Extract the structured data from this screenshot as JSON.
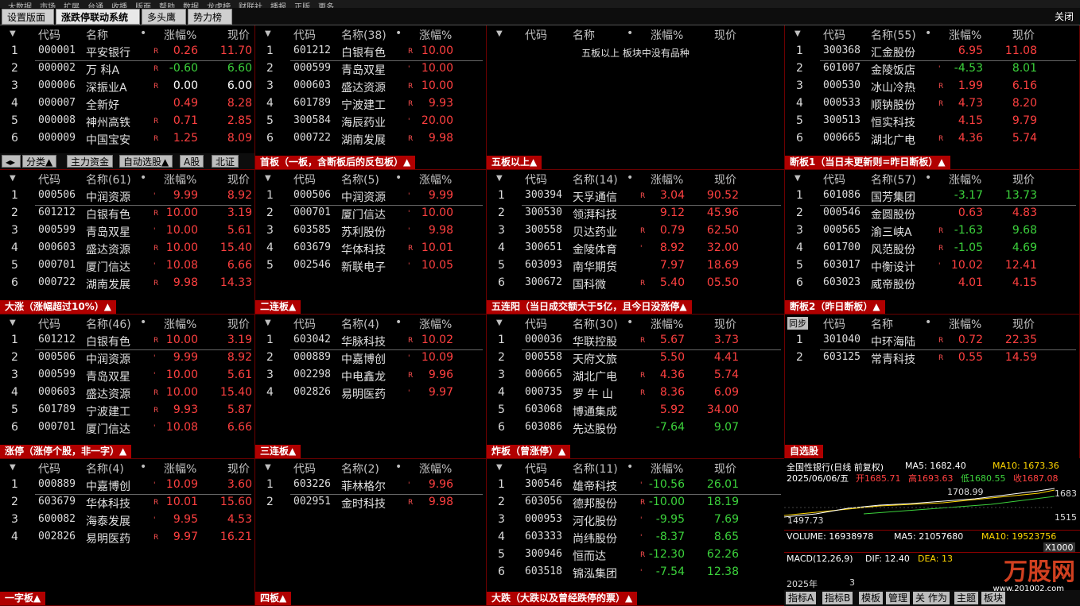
{
  "menubar": [
    "大数据",
    "市场",
    "扩展",
    "台通",
    "收播",
    "版面",
    "帮助",
    "数据",
    "龙虎榜",
    "财联社",
    "播报",
    "正版",
    "更多"
  ],
  "tabs": [
    {
      "label": "设置版面"
    },
    {
      "label": "涨跌停联动系统",
      "active": true
    },
    {
      "label": "多头鹰"
    },
    {
      "label": "势力榜"
    }
  ],
  "close_label": "关闭",
  "ctrl_buttons": [
    "分类▲",
    "主力资金",
    "自动选股▲",
    "A股",
    "北证"
  ],
  "panels": [
    {
      "id": "p1",
      "hdr_name": "名称",
      "foot": "",
      "rows": [
        {
          "code": "000001",
          "name": "平安银行",
          "mk": "R",
          "chg": "0.26",
          "price": "11.70",
          "dir": "up"
        },
        {
          "code": "000002",
          "name": "万 科A",
          "mk": "R",
          "chg": "-0.60",
          "price": "6.60",
          "dir": "dn"
        },
        {
          "code": "000006",
          "name": "深振业A",
          "mk": "R",
          "chg": "0.00",
          "price": "6.00",
          "dir": "fl"
        },
        {
          "code": "000007",
          "name": "全新好",
          "mk": "",
          "chg": "0.49",
          "price": "8.28",
          "dir": "up"
        },
        {
          "code": "000008",
          "name": "神州高铁",
          "mk": "R",
          "chg": "0.71",
          "price": "2.85",
          "dir": "up"
        },
        {
          "code": "000009",
          "name": "中国宝安",
          "mk": "R",
          "chg": "1.25",
          "price": "8.09",
          "dir": "up"
        }
      ]
    },
    {
      "id": "p2",
      "hdr_name": "名称(38)",
      "foot": "首板（一板，含断板后的反包板）▲",
      "rows": [
        {
          "code": "601212",
          "name": "白银有色",
          "mk": "R",
          "chg": "10.00",
          "dir": "up"
        },
        {
          "code": "000599",
          "name": "青岛双星",
          "mk": "'",
          "chg": "10.00",
          "dir": "up"
        },
        {
          "code": "000603",
          "name": "盛达资源",
          "mk": "R",
          "chg": "10.00",
          "dir": "up"
        },
        {
          "code": "601789",
          "name": "宁波建工",
          "mk": "R",
          "chg": "9.93",
          "dir": "up"
        },
        {
          "code": "300584",
          "name": "海辰药业",
          "mk": "'",
          "chg": "20.00",
          "dir": "up"
        },
        {
          "code": "000722",
          "name": "湖南发展",
          "mk": "R",
          "chg": "9.98",
          "dir": "up"
        }
      ]
    },
    {
      "id": "p3",
      "hdr_name": "名称",
      "foot": "五板以上▲",
      "empty": "五板以上 板块中没有品种",
      "rows": []
    },
    {
      "id": "p4",
      "hdr_name": "名称(55)",
      "foot": "断板1（当日未更新则=昨日断板）▲",
      "rows": [
        {
          "code": "300368",
          "name": "汇金股份",
          "mk": "",
          "chg": "6.95",
          "price": "11.08",
          "dir": "up"
        },
        {
          "code": "601007",
          "name": "金陵饭店",
          "mk": "'",
          "chg": "-4.53",
          "price": "8.01",
          "dir": "dn"
        },
        {
          "code": "000530",
          "name": "冰山冷热",
          "mk": "R",
          "chg": "1.99",
          "price": "6.16",
          "dir": "up"
        },
        {
          "code": "000533",
          "name": "顺钠股份",
          "mk": "R",
          "chg": "4.73",
          "price": "8.20",
          "dir": "up"
        },
        {
          "code": "300513",
          "name": "恒实科技",
          "mk": "",
          "chg": "4.15",
          "price": "9.79",
          "dir": "up"
        },
        {
          "code": "000665",
          "name": "湖北广电",
          "mk": "R",
          "chg": "4.36",
          "price": "5.74",
          "dir": "up"
        }
      ]
    },
    {
      "id": "p5",
      "hdr_name": "名称(61)",
      "foot": "大涨（涨幅超过10%）▲",
      "rows": [
        {
          "code": "000506",
          "name": "中润资源",
          "mk": "'",
          "chg": "9.99",
          "price": "8.92",
          "dir": "up"
        },
        {
          "code": "601212",
          "name": "白银有色",
          "mk": "R",
          "chg": "10.00",
          "price": "3.19",
          "dir": "up"
        },
        {
          "code": "000599",
          "name": "青岛双星",
          "mk": "'",
          "chg": "10.00",
          "price": "5.61",
          "dir": "up"
        },
        {
          "code": "000603",
          "name": "盛达资源",
          "mk": "R",
          "chg": "10.00",
          "price": "15.40",
          "dir": "up"
        },
        {
          "code": "000701",
          "name": "厦门信达",
          "mk": "'",
          "chg": "10.08",
          "price": "6.66",
          "dir": "up"
        },
        {
          "code": "000722",
          "name": "湖南发展",
          "mk": "R",
          "chg": "9.98",
          "price": "14.33",
          "dir": "up"
        }
      ]
    },
    {
      "id": "p6",
      "hdr_name": "名称(5)",
      "foot": "二连板▲",
      "rows": [
        {
          "code": "000506",
          "name": "中润资源",
          "mk": "'",
          "chg": "9.99",
          "dir": "up"
        },
        {
          "code": "000701",
          "name": "厦门信达",
          "mk": "'",
          "chg": "10.00",
          "dir": "up"
        },
        {
          "code": "603585",
          "name": "苏利股份",
          "mk": "'",
          "chg": "9.98",
          "dir": "up"
        },
        {
          "code": "603679",
          "name": "华体科技",
          "mk": "R",
          "chg": "10.01",
          "dir": "up"
        },
        {
          "code": "002546",
          "name": "新联电子",
          "mk": "'",
          "chg": "10.05",
          "dir": "up"
        }
      ]
    },
    {
      "id": "p7",
      "hdr_name": "名称(14)",
      "foot": "五连阳（当日成交额大于5亿，且今日没涨停▲",
      "rows": [
        {
          "code": "300394",
          "name": "天孚通信",
          "mk": "R",
          "chg": "3.04",
          "price": "90.52",
          "dir": "up"
        },
        {
          "code": "300530",
          "name": "领湃科技",
          "mk": "",
          "chg": "9.12",
          "price": "45.96",
          "dir": "up"
        },
        {
          "code": "300558",
          "name": "贝达药业",
          "mk": "R",
          "chg": "0.79",
          "price": "62.50",
          "dir": "up"
        },
        {
          "code": "300651",
          "name": "金陵体育",
          "mk": "'",
          "chg": "8.92",
          "price": "32.00",
          "dir": "up"
        },
        {
          "code": "603093",
          "name": "南华期货",
          "mk": "",
          "chg": "7.97",
          "price": "18.69",
          "dir": "up"
        },
        {
          "code": "300672",
          "name": "国科微",
          "mk": "R",
          "chg": "5.40",
          "price": "05.50",
          "dir": "up"
        }
      ]
    },
    {
      "id": "p8",
      "hdr_name": "名称(57)",
      "foot": "断板2（昨日断板）▲",
      "rows": [
        {
          "code": "601086",
          "name": "国芳集团",
          "mk": "",
          "chg": "-3.17",
          "price": "13.73",
          "dir": "dn"
        },
        {
          "code": "000546",
          "name": "金圆股份",
          "mk": "",
          "chg": "0.63",
          "price": "4.83",
          "dir": "up"
        },
        {
          "code": "000565",
          "name": "渝三峡A",
          "mk": "R",
          "chg": "-1.63",
          "price": "9.68",
          "dir": "dn"
        },
        {
          "code": "601700",
          "name": "风范股份",
          "mk": "R",
          "chg": "-1.05",
          "price": "4.69",
          "dir": "dn"
        },
        {
          "code": "603017",
          "name": "中衡设计",
          "mk": "'",
          "chg": "10.02",
          "price": "12.41",
          "dir": "up"
        },
        {
          "code": "603023",
          "name": "威帝股份",
          "mk": "",
          "chg": "4.01",
          "price": "4.15",
          "dir": "up"
        }
      ]
    },
    {
      "id": "p9",
      "hdr_name": "名称(46)",
      "foot": "涨停（涨停个股，非一字）▲",
      "rows": [
        {
          "code": "601212",
          "name": "白银有色",
          "mk": "R",
          "chg": "10.00",
          "price": "3.19",
          "dir": "up"
        },
        {
          "code": "000506",
          "name": "中润资源",
          "mk": "'",
          "chg": "9.99",
          "price": "8.92",
          "dir": "up"
        },
        {
          "code": "000599",
          "name": "青岛双星",
          "mk": "'",
          "chg": "10.00",
          "price": "5.61",
          "dir": "up"
        },
        {
          "code": "000603",
          "name": "盛达资源",
          "mk": "R",
          "chg": "10.00",
          "price": "15.40",
          "dir": "up"
        },
        {
          "code": "601789",
          "name": "宁波建工",
          "mk": "R",
          "chg": "9.93",
          "price": "5.87",
          "dir": "up"
        },
        {
          "code": "000701",
          "name": "厦门信达",
          "mk": "'",
          "chg": "10.08",
          "price": "6.66",
          "dir": "up"
        }
      ]
    },
    {
      "id": "p10",
      "hdr_name": "名称(4)",
      "foot": "三连板▲",
      "rows": [
        {
          "code": "603042",
          "name": "华脉科技",
          "mk": "R",
          "chg": "10.02",
          "dir": "up"
        },
        {
          "code": "000889",
          "name": "中嘉博创",
          "mk": "'",
          "chg": "10.09",
          "dir": "up"
        },
        {
          "code": "002298",
          "name": "中电鑫龙",
          "mk": "R",
          "chg": "9.96",
          "dir": "up"
        },
        {
          "code": "002826",
          "name": "易明医药",
          "mk": "'",
          "chg": "9.97",
          "dir": "up"
        }
      ]
    },
    {
      "id": "p11",
      "hdr_name": "名称(30)",
      "foot": "炸板（曾涨停）▲",
      "rows": [
        {
          "code": "000036",
          "name": "华联控股",
          "mk": "R",
          "chg": "5.67",
          "price": "3.73",
          "dir": "up"
        },
        {
          "code": "000558",
          "name": "天府文旅",
          "mk": "",
          "chg": "5.50",
          "price": "4.41",
          "dir": "up"
        },
        {
          "code": "000665",
          "name": "湖北广电",
          "mk": "R",
          "chg": "4.36",
          "price": "5.74",
          "dir": "up"
        },
        {
          "code": "000735",
          "name": "罗 牛 山",
          "mk": "R",
          "chg": "8.36",
          "price": "6.09",
          "dir": "up"
        },
        {
          "code": "603068",
          "name": "博通集成",
          "mk": "",
          "chg": "5.92",
          "price": "34.00",
          "dir": "up"
        },
        {
          "code": "603086",
          "name": "先达股份",
          "mk": "",
          "chg": "-7.64",
          "price": "9.07",
          "dir": "dn"
        }
      ]
    },
    {
      "id": "p12",
      "hdr_name": "名称",
      "foot": "自选股",
      "sync": "同步",
      "rows": [
        {
          "code": "301040",
          "name": "中环海陆",
          "mk": "R",
          "chg": "0.72",
          "price": "22.35",
          "dir": "up"
        },
        {
          "code": "603125",
          "name": "常青科技",
          "mk": "R",
          "chg": "0.55",
          "price": "14.59",
          "dir": "up"
        }
      ]
    },
    {
      "id": "p13",
      "hdr_name": "名称(4)",
      "foot": "一字板▲",
      "rows": [
        {
          "code": "000889",
          "name": "中嘉博创",
          "mk": "'",
          "chg": "10.09",
          "price": "3.60",
          "dir": "up"
        },
        {
          "code": "603679",
          "name": "华体科技",
          "mk": "R",
          "chg": "10.01",
          "price": "15.60",
          "dir": "up"
        },
        {
          "code": "600082",
          "name": "海泰发展",
          "mk": "'",
          "chg": "9.95",
          "price": "4.53",
          "dir": "up"
        },
        {
          "code": "002826",
          "name": "易明医药",
          "mk": "R",
          "chg": "9.97",
          "price": "16.21",
          "dir": "up"
        }
      ]
    },
    {
      "id": "p14",
      "hdr_name": "名称(2)",
      "foot": "四板▲",
      "rows": [
        {
          "code": "603226",
          "name": "菲林格尔",
          "mk": "'",
          "chg": "9.96",
          "dir": "up"
        },
        {
          "code": "002951",
          "name": "金时科技",
          "mk": "R",
          "chg": "9.98",
          "dir": "up"
        }
      ]
    },
    {
      "id": "p15",
      "hdr_name": "名称(11)",
      "foot": "大跌（大跌以及曾经跌停的票）▲",
      "rows": [
        {
          "code": "300546",
          "name": "雄帝科技",
          "mk": "'",
          "chg": "-10.56",
          "price": "26.01",
          "dir": "dn"
        },
        {
          "code": "603056",
          "name": "德邦股份",
          "mk": "R",
          "chg": "-10.00",
          "price": "18.19",
          "dir": "dn"
        },
        {
          "code": "000953",
          "name": "河化股份",
          "mk": "'",
          "chg": "-9.95",
          "price": "7.69",
          "dir": "dn"
        },
        {
          "code": "603333",
          "name": "尚纬股份",
          "mk": "'",
          "chg": "-8.37",
          "price": "8.65",
          "dir": "dn"
        },
        {
          "code": "300946",
          "name": "恒而达",
          "mk": "R",
          "chg": "-12.30",
          "price": "62.26",
          "dir": "dn"
        },
        {
          "code": "603518",
          "name": "锦泓集团",
          "mk": "'",
          "chg": "-7.54",
          "price": "12.38",
          "dir": "dn"
        }
      ]
    }
  ],
  "headers": {
    "idx": "",
    "code": "代码",
    "dot": "•",
    "chg": "涨幅%",
    "price": "现价"
  },
  "chart": {
    "title": "全国性银行(日线 前复权)",
    "ma5": "MA5: 1682.40",
    "ma10": "MA10: 1673.36",
    "date": "2025/06/06/五",
    "open": "开1685.71",
    "high": "高1693.63",
    "low": "低1680.55",
    "close": "收1687.08",
    "peak_label": "1708.99",
    "low_label": "1497.73",
    "axis_hi": "1683",
    "axis_lo": "1515",
    "volume": "VOLUME: 16938978",
    "vol_ma5": "MA5: 21057680",
    "vol_ma10": "MA10: 19523756",
    "vol_scale": "X1000",
    "macd": "MACD(12,26,9)",
    "dif": "DIF: 12.40",
    "dea": "DEA: 13",
    "year": "2025年",
    "month": "3",
    "colors": {
      "up": "#ff4040",
      "down": "#3cd23c",
      "ma5": "#ffffff",
      "ma10": "#ffd700"
    }
  },
  "bottom_buttons": [
    "指标A",
    "指标B",
    "模板",
    "管理",
    "关 作为",
    "主题",
    "板块"
  ],
  "watermark": "万股网",
  "watermark_url": "www.201002.com"
}
